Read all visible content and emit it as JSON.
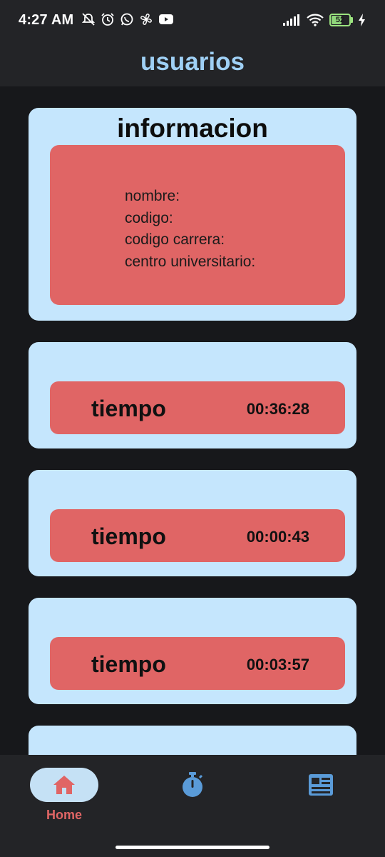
{
  "status_bar": {
    "time": "4:27 AM",
    "battery_level": "52",
    "battery_fraction": 0.52,
    "left_icons": [
      "mute-icon",
      "alarm-icon",
      "whatsapp-icon",
      "fan-icon",
      "youtube-icon"
    ],
    "right_icons": [
      "signal-icon",
      "wifi-icon",
      "battery-icon",
      "charging-icon"
    ]
  },
  "app_bar": {
    "title": "usuarios"
  },
  "info_card": {
    "title": "informacion",
    "lines": [
      "nombre:",
      "codigo:",
      "codigo carrera:",
      "centro universitario:"
    ]
  },
  "timer_cards": [
    {
      "label": "tiempo",
      "value": "00:36:28"
    },
    {
      "label": "tiempo",
      "value": "00:00:43"
    },
    {
      "label": "tiempo",
      "value": "00:03:57"
    }
  ],
  "bottom_nav": {
    "items": [
      {
        "label": "Home",
        "icon": "home-icon",
        "active": true
      },
      {
        "label": "",
        "icon": "stopwatch-icon",
        "active": false
      },
      {
        "label": "",
        "icon": "news-icon",
        "active": false
      }
    ]
  },
  "colors": {
    "background": "#17181b",
    "bar": "#232427",
    "card": "#c5e6fd",
    "accent_red": "#e06565",
    "title_blue": "#9fd0f5",
    "icon_blue": "#5a9bd8"
  }
}
